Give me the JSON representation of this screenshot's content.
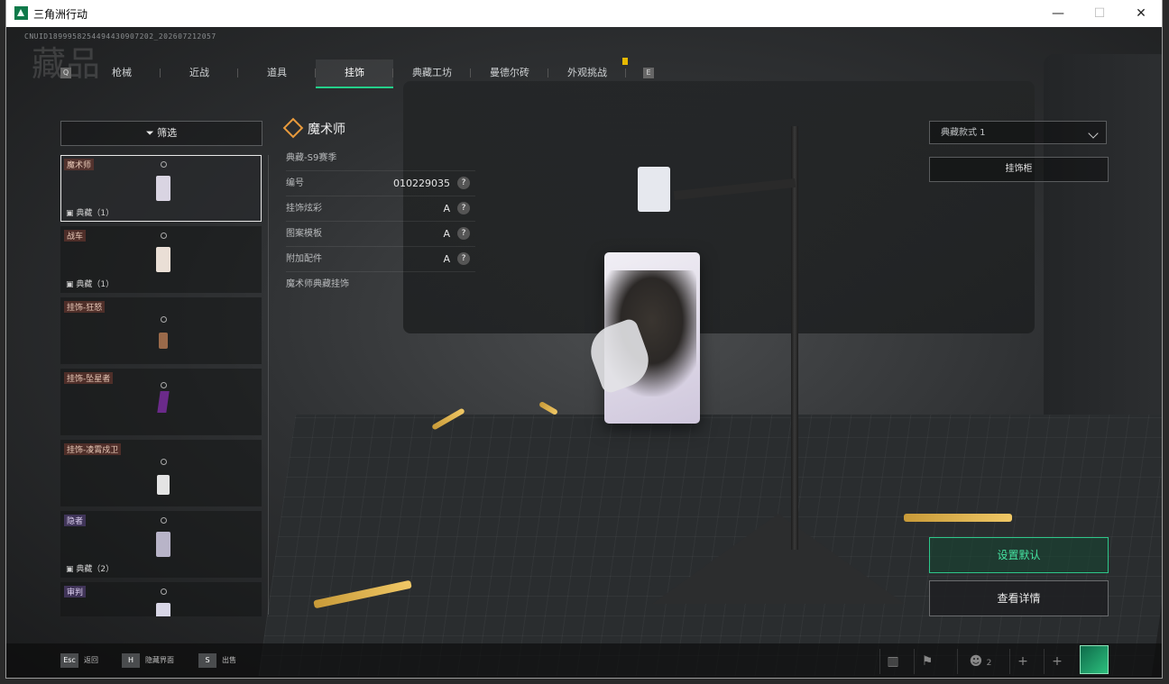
{
  "window": {
    "title": "三角洲行动",
    "minimize": "—",
    "maximize": "☐",
    "close": "✕"
  },
  "game": {
    "cnuid": "CNUID1899958254494430907202_202607212057",
    "bg_title": "藏品",
    "tabs": [
      "枪械",
      "近战",
      "道具",
      "挂饰",
      "典藏工坊",
      "曼德尔砖",
      "外观挑战"
    ],
    "active_tab": "挂饰",
    "tab_key_left": "Q",
    "tab_key_right": "E",
    "filter_label": "筛选",
    "list": [
      {
        "label": "魔术师",
        "sub": "典藏（1）",
        "selected": true,
        "type": "card"
      },
      {
        "label": "战车",
        "sub": "典藏（1）",
        "selected": false,
        "type": "card"
      },
      {
        "label": "挂饰-狂怒",
        "sub": "",
        "selected": false,
        "type": "small"
      },
      {
        "label": "挂饰-坠星者",
        "sub": "",
        "selected": false,
        "type": "gem"
      },
      {
        "label": "挂饰-凌霄戍卫",
        "sub": "",
        "selected": false,
        "type": "small"
      },
      {
        "label": "隐者",
        "sub": "典藏（2）",
        "selected": false,
        "type": "card"
      },
      {
        "label": "审判",
        "sub": "",
        "selected": false,
        "type": "card"
      }
    ],
    "detail": {
      "name": "魔术师",
      "season": "典藏-S9赛季",
      "rows": [
        {
          "label": "编号",
          "value": "010229035"
        },
        {
          "label": "挂饰炫彩",
          "value": "A"
        },
        {
          "label": "图案模板",
          "value": "A"
        },
        {
          "label": "附加配件",
          "value": "A"
        }
      ],
      "desc": "魔术师典藏挂饰",
      "help": "?"
    },
    "dropdown_value": "典藏款式 1",
    "cabinet_btn": "挂饰柜",
    "set_default_btn": "设置默认",
    "view_detail_btn": "查看详情",
    "bottom_hints": [
      {
        "key": "Esc",
        "label": "返回"
      },
      {
        "key": "H",
        "label": "隐藏界面"
      },
      {
        "key": "S",
        "label": "出售"
      }
    ],
    "hud": {
      "squad_count": "2",
      "plus": "+"
    }
  }
}
